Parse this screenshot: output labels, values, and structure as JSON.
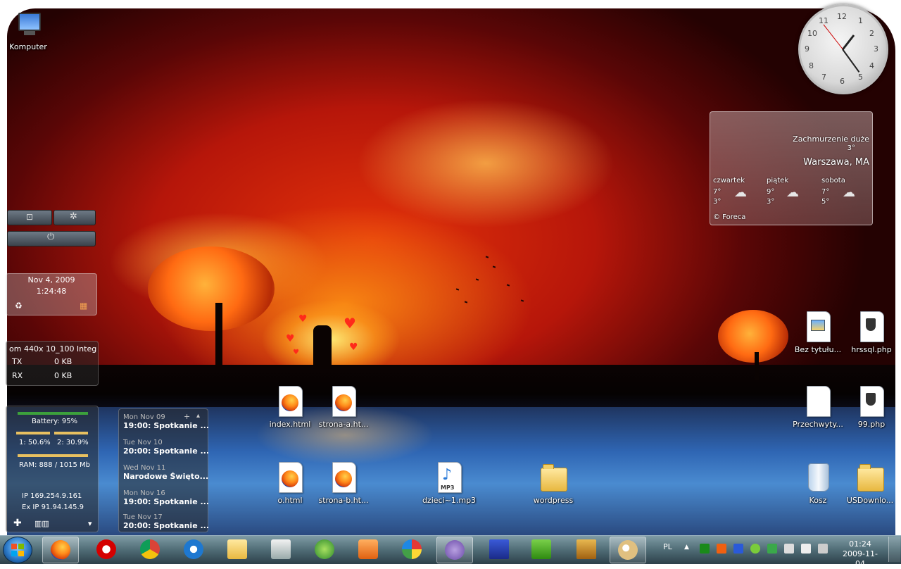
{
  "desktop": {
    "computer_icon": "Komputer",
    "icons": {
      "index": "index.html",
      "strona_a": "strona-a.ht...",
      "o": "o.html",
      "strona_b": "strona-b.ht...",
      "mp3": "dzieci~1.mp3",
      "mp3_tag": "MP3",
      "wordpress": "wordpress",
      "bez_tytulu": "Bez tytułu...",
      "hrssql": "hrssql.php",
      "przechwyty": "Przechwyty...",
      "php99": "99.php",
      "kosz": "Kosz",
      "usdownload": "USDownlo..."
    }
  },
  "gadgets": {
    "datetime": {
      "date": "Nov 4, 2009",
      "time": "1:24:48"
    },
    "network": {
      "adapter": "om 440x 10_100 Integ",
      "tx_label": "TX",
      "tx_value": "0 KB",
      "rx_label": "RX",
      "rx_value": "0 KB"
    },
    "sysmon": {
      "battery": "Battery: 95%",
      "cpu1": "1: 50.6%",
      "cpu2": "2: 30.9%",
      "ram": "RAM: 888 / 1015 Mb",
      "ip": "IP 169.254.9.161",
      "ex_ip": "Ex IP 91.94.145.9"
    },
    "calendar": {
      "items": [
        {
          "day": "Mon Nov 09",
          "event": "19:00: Spotkanie ..."
        },
        {
          "day": "Tue Nov 10",
          "event": "20:00: Spotkanie ..."
        },
        {
          "day": "Wed Nov 11",
          "event": "Narodowe Święto..."
        },
        {
          "day": "Mon Nov 16",
          "event": "19:00: Spotkanie ..."
        },
        {
          "day": "Tue Nov 17",
          "event": "20:00: Spotkanie ..."
        }
      ]
    },
    "clock": {
      "numbers": [
        "12",
        "1",
        "2",
        "3",
        "4",
        "5",
        "6",
        "7",
        "8",
        "9",
        "10",
        "11"
      ]
    },
    "weather": {
      "condition": "Zachmurzenie duże",
      "temp": "3°",
      "city": "Warszawa, MA",
      "days": [
        {
          "name": "czwartek",
          "hi": "7°",
          "lo": "3°"
        },
        {
          "name": "piątek",
          "hi": "9°",
          "lo": "3°"
        },
        {
          "name": "sobota",
          "hi": "7°",
          "lo": "5°"
        }
      ],
      "credit": "© Foreca"
    }
  },
  "taskbar": {
    "language": "PL",
    "time": "01:24",
    "date": "2009-11-04",
    "apps": [
      "Firefox",
      "Opera",
      "Chrome",
      "Internet Explorer",
      "Windows Explorer",
      "Notepad++",
      "Windows Media Center",
      "Media Player",
      "Picasa",
      "Pidgin",
      "Save",
      "uTorrent",
      "DOSBox",
      "Paint"
    ]
  },
  "colors": {
    "accent": "#2a78c8",
    "taskbar": "#46646e"
  }
}
